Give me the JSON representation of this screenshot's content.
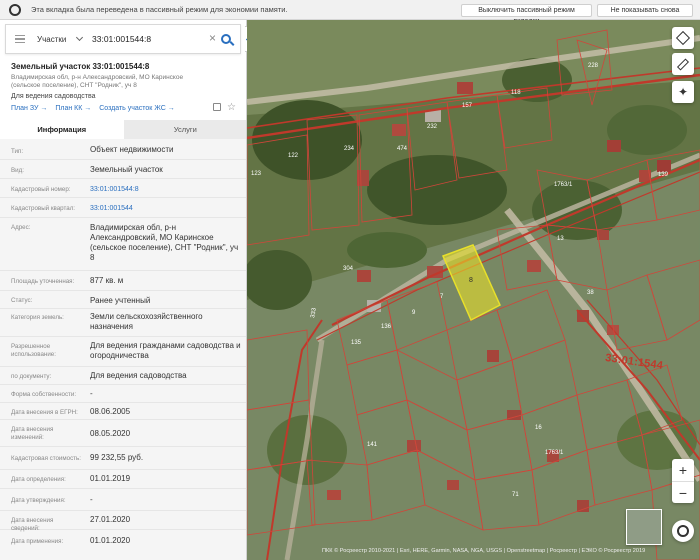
{
  "browser": {
    "notice": "Эта вкладка была переведена в пассивный режим для экономии памяти.",
    "disable_button": "Выключить пассивный режим вкладки",
    "dont_show_button": "Не показывать снова"
  },
  "search": {
    "type_label": "Участки",
    "query": "33:01:001544:8"
  },
  "parcel": {
    "title": "Земельный участок 33:01:001544:8",
    "address_short": "Владимирская обл, р-н Александровский, МО Каринское (сельское поселение), СНТ \"Родник\", уч 8",
    "purpose": "Для ведения садоводства",
    "links": [
      "План ЗУ →",
      "План КК →",
      "Создать участок ЖС →"
    ]
  },
  "tabs": {
    "info": "Информация",
    "services": "Услуги"
  },
  "properties": [
    {
      "label": "Тип:",
      "value": "Объект недвижимости"
    },
    {
      "label": "Вид:",
      "value": "Земельный участок"
    },
    {
      "label": "Кадастровый номер:",
      "value": "33:01:001544:8"
    },
    {
      "label": "Кадастровый квартал:",
      "value": "33:01:001544"
    },
    {
      "label": "Адрес:",
      "value": "Владимирская обл, р-н Александровский, МО Каринское (сельское поселение), СНТ \"Родник\", уч 8"
    },
    {
      "label": "Площадь уточненная:",
      "value": "877 кв. м"
    },
    {
      "label": "Статус:",
      "value": "Ранее учтенный"
    },
    {
      "label": "Категория земель:",
      "value": "Земли сельскохозяйственного назначения"
    },
    {
      "label": "Разрешенное использование:",
      "value": "Для ведения гражданами садоводства и огородничества"
    },
    {
      "label": "по документу:",
      "value": "Для ведения садоводства"
    },
    {
      "label": "Форма собственности:",
      "value": "-"
    },
    {
      "label": "Дата внесения в ЕГРН:",
      "value": "08.06.2005"
    },
    {
      "label": "Дата внесения изменений:",
      "value": "08.05.2020"
    },
    {
      "label": "Кадастровая стоимость:",
      "value": "99 232,55 руб."
    },
    {
      "label": "Дата определения:",
      "value": "01.01.2019"
    },
    {
      "label": "Дата утверждения:",
      "value": "-"
    },
    {
      "label": "Дата внесения сведений:",
      "value": "27.01.2020"
    },
    {
      "label": "Дата применения:",
      "value": "01.01.2020"
    }
  ],
  "map": {
    "quarter_label": "33:01:1544",
    "selected_parcel_number": "8",
    "attribution": "ПКК © Росреестр 2010-2021 | Esri, HERE, Garmin, NASA, NGA, USGS | Openstreetmap | Росреестр | ЕЭКО © Росреестр 2019",
    "parcel_numbers": [
      "228",
      "157",
      "118",
      "232",
      "474",
      "234",
      "122",
      "123",
      "139",
      "1763/1",
      "13",
      "304",
      "7",
      "9",
      "136",
      "135",
      "38",
      "16",
      "141",
      "71",
      "1763/1",
      "333"
    ],
    "accent_color": "#c0392b",
    "selection_color": "#e8e02a"
  }
}
